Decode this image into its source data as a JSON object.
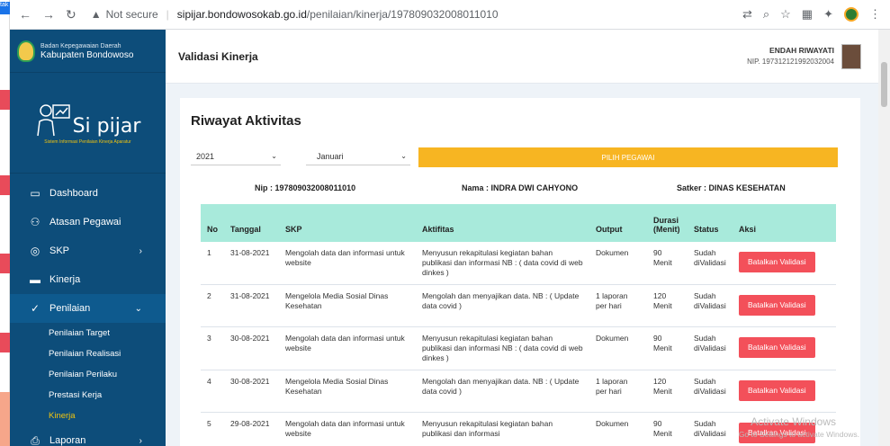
{
  "browser": {
    "tab_stub": "tak",
    "security": "Not secure",
    "url_host": "sipijar.bondowosokab.go.id",
    "url_path": "/penilaian/kinerja/197809032008011010"
  },
  "sidebar": {
    "org_line1": "Badan Kepegawaian Daerah",
    "org_line2": "Kabupaten Bondowoso",
    "app_name": "Si pijar",
    "app_tagline": "Sistem Informasi Penilaian Kinerja Aparatur",
    "items": [
      {
        "label": "Dashboard",
        "icon": "monitor-icon"
      },
      {
        "label": "Atasan Pegawai",
        "icon": "user-icon"
      },
      {
        "label": "SKP",
        "icon": "target-icon"
      },
      {
        "label": "Kinerja",
        "icon": "briefcase-icon"
      },
      {
        "label": "Penilaian",
        "icon": "check-icon"
      },
      {
        "label": "Laporan",
        "icon": "printer-icon"
      }
    ],
    "sub_items": [
      "Penilaian Target",
      "Penilaian Realisasi",
      "Penilaian Perilaku",
      "Prestasi Kerja",
      "Kinerja"
    ]
  },
  "header": {
    "title": "Validasi Kinerja",
    "user_name": "ENDAH RIWAYATI",
    "user_nip": "NIP. 197312121992032004"
  },
  "card": {
    "title": "Riwayat Aktivitas",
    "year": "2021",
    "month": "Januari",
    "pick_label": "PILIH PEGAWAI",
    "nip": "Nip : 197809032008011010",
    "nama": "Nama : INDRA DWI CAHYONO",
    "satker": "Satker : DINAS KESEHATAN"
  },
  "table": {
    "headers": [
      "No",
      "Tanggal",
      "SKP",
      "Aktifitas",
      "Output",
      "Durasi (Menit)",
      "Status",
      "Aksi"
    ],
    "rows": [
      {
        "no": "1",
        "tanggal": "31-08-2021",
        "skp": "Mengolah data dan informasi untuk website",
        "aktifitas": "Menyusun rekapitulasi kegiatan bahan publikasi dan informasi NB : ( data covid di web dinkes )",
        "output": "Dokumen",
        "durasi": "90 Menit",
        "status": "Sudah diValidasi",
        "aksi": "Batalkan Validasi"
      },
      {
        "no": "2",
        "tanggal": "31-08-2021",
        "skp": "Mengelola Media Sosial Dinas Kesehatan",
        "aktifitas": "Mengolah dan menyajikan data. NB : ( Update data covid )",
        "output": "1 laporan per hari",
        "durasi": "120 Menit",
        "status": "Sudah diValidasi",
        "aksi": "Batalkan Validasi"
      },
      {
        "no": "3",
        "tanggal": "30-08-2021",
        "skp": "Mengolah data dan informasi untuk website",
        "aktifitas": "Menyusun rekapitulasi kegiatan bahan publikasi dan informasi NB : ( data covid di web dinkes )",
        "output": "Dokumen",
        "durasi": "90 Menit",
        "status": "Sudah diValidasi",
        "aksi": "Batalkan Validasi"
      },
      {
        "no": "4",
        "tanggal": "30-08-2021",
        "skp": "Mengelola Media Sosial Dinas Kesehatan",
        "aktifitas": "Mengolah dan menyajikan data. NB : ( Update data covid )",
        "output": "1 laporan per hari",
        "durasi": "120 Menit",
        "status": "Sudah diValidasi",
        "aksi": "Batalkan Validasi"
      },
      {
        "no": "5",
        "tanggal": "29-08-2021",
        "skp": "Mengolah data dan informasi untuk website",
        "aktifitas": "Menyusun rekapitulasi kegiatan bahan publikasi dan informasi",
        "output": "Dokumen",
        "durasi": "90 Menit",
        "status": "Sudah diValidasi",
        "aksi": "Batalkan Validasi"
      }
    ]
  },
  "watermark": {
    "line1": "Activate Windows",
    "line2": "Go to Settings to activate Windows."
  }
}
